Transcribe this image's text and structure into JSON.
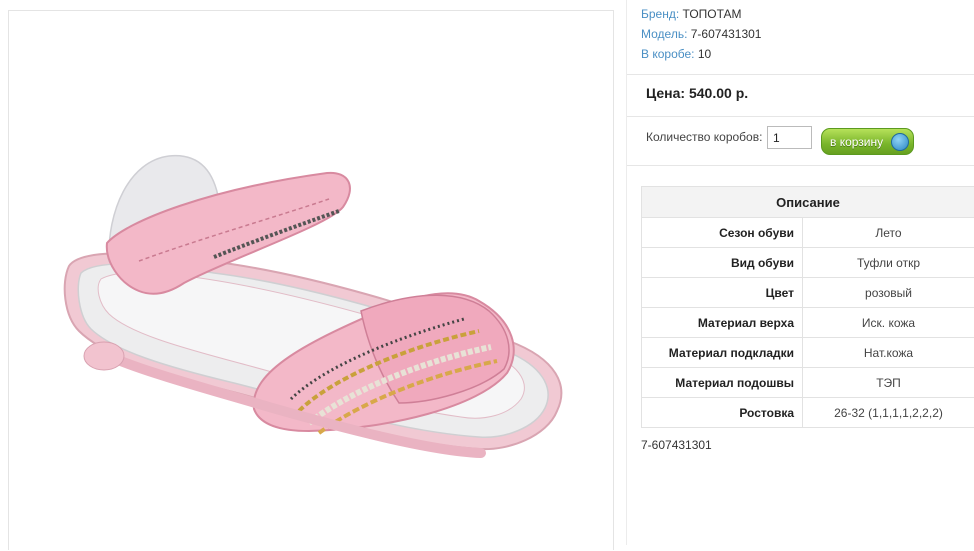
{
  "product": {
    "brand_label": "Бренд:",
    "brand": "ТОПОТАМ",
    "model_label": "Модель:",
    "model": "7-607431301",
    "box_label": "В коробе:",
    "box_qty": "10"
  },
  "price": {
    "text": "Цена: 540.00 р."
  },
  "order": {
    "qty_label": "Количество коробов:",
    "qty_value": "1",
    "cart_label": "в корзину"
  },
  "description": {
    "title": "Описание",
    "rows": [
      {
        "name": "Сезон обуви",
        "value": "Лето"
      },
      {
        "name": "Вид обуви",
        "value": "Туфли откр"
      },
      {
        "name": "Цвет",
        "value": "розовый"
      },
      {
        "name": "Материал верха",
        "value": "Иск. кожа"
      },
      {
        "name": "Материал подкладки",
        "value": "Нат.кожа"
      },
      {
        "name": "Материал подошвы",
        "value": "ТЭП"
      },
      {
        "name": "Ростовка",
        "value": "26-32 (1,1,1,1,2,2,2)"
      }
    ]
  },
  "sku_footer": "7-607431301",
  "colors": {
    "link": "#4a8fc4",
    "cart_green": "#79b52b",
    "shoe_pink": "#f3b8c8"
  }
}
